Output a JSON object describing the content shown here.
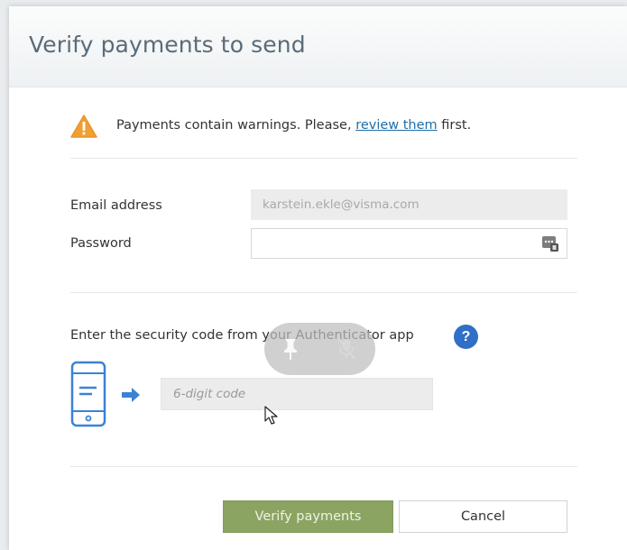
{
  "dialog": {
    "title": "Verify payments to send"
  },
  "warning": {
    "text_before": "Payments contain warnings. Please, ",
    "link_text": "review them",
    "text_after": " first."
  },
  "form": {
    "email_label": "Email address",
    "email_value": "karstein.ekle@visma.com",
    "password_label": "Password",
    "password_value": ""
  },
  "security": {
    "label": "Enter the security code from your Authenticator app",
    "help_symbol": "?",
    "code_placeholder": "6-digit code"
  },
  "buttons": {
    "verify_label": "Verify payments",
    "cancel_label": "Cancel"
  },
  "colors": {
    "warning_icon": "#f0a030",
    "help_icon": "#2f6fc6",
    "phone_outline": "#3b82d6",
    "arrow": "#3b82d6",
    "primary_button": "#8ba462",
    "link": "#1f6fa8"
  },
  "icons": {
    "warning": "warning-triangle-icon",
    "password": "password-key-icon",
    "help": "help-icon",
    "phone": "phone-icon",
    "arrow": "arrow-right-icon",
    "pin": "pin-icon",
    "mic_off": "mic-off-icon",
    "cursor": "cursor-icon"
  }
}
